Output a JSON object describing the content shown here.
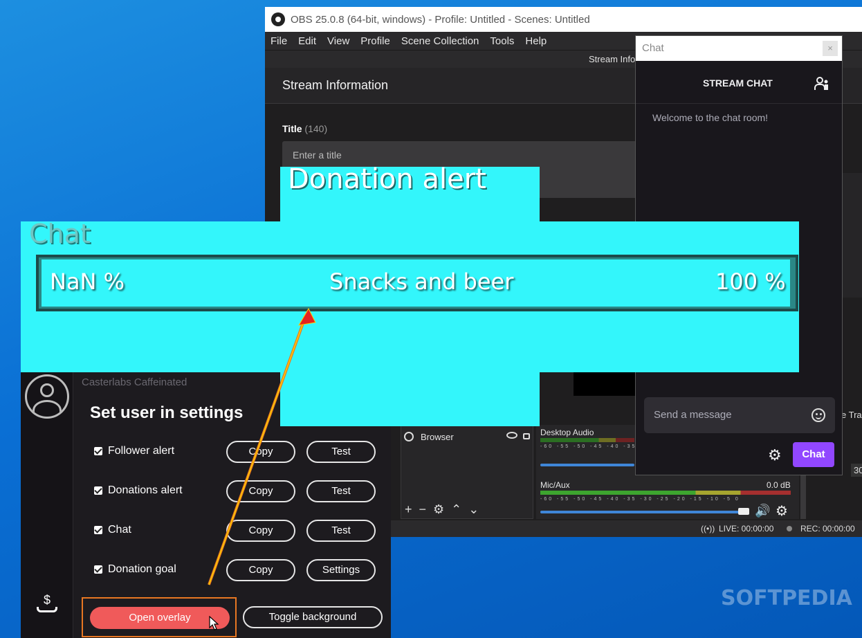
{
  "obs": {
    "title": "OBS 25.0.8 (64-bit, windows) - Profile: Untitled - Scenes: Untitled",
    "menu": [
      "File",
      "Edit",
      "View",
      "Profile",
      "Scene Collection",
      "Tools",
      "Help"
    ],
    "dock_label": "Stream Info",
    "stream_info_header": "Stream Information",
    "title_label": "Title",
    "title_count": "(140)",
    "title_placeholder": "Enter a title",
    "source_name": "Browser",
    "mixer": {
      "desktop_label": "Desktop Audio",
      "mic_label": "Mic/Aux",
      "mic_db": "0.0 dB",
      "tick_labels": "-60 -55 -50 -45 -40 -35 -30 -25 -20 -15 -10 -5 0"
    },
    "status": {
      "live": "LIVE: 00:00:00",
      "rec": "REC: 00:00:00"
    },
    "right_edge_text": "e Tra",
    "right_edge_num": "30"
  },
  "chat": {
    "window_title": "Chat",
    "close_symbol": "×",
    "header": "STREAM CHAT",
    "welcome": "Welcome to the chat room!",
    "input_placeholder": "Send a message",
    "send_label": "Chat"
  },
  "overlay": {
    "donation_alert": "Donation alert",
    "chat_label": "Chat",
    "goal_left": "NaN %",
    "goal_center": "Snacks and beer",
    "goal_right": "100 %"
  },
  "caster": {
    "app_title": "Casterlabs Caffeinated",
    "user_text": "Set user in settings",
    "rows": [
      {
        "label": "Follower alert",
        "btn1": "Copy",
        "btn2": "Test"
      },
      {
        "label": "Donations alert",
        "btn1": "Copy",
        "btn2": "Test"
      },
      {
        "label": "Chat",
        "btn1": "Copy",
        "btn2": "Test"
      },
      {
        "label": "Donation goal",
        "btn1": "Copy",
        "btn2": "Settings"
      }
    ],
    "open_overlay": "Open overlay",
    "toggle_background": "Toggle background",
    "donate_icon": "$"
  },
  "watermark": "SOFTPEDIA",
  "colors": {
    "overlay_cyan": "#33f6fb",
    "chat_send_purple": "#9147ff",
    "open_overlay_red": "#f05a5a",
    "highlight_orange": "#e87722"
  }
}
